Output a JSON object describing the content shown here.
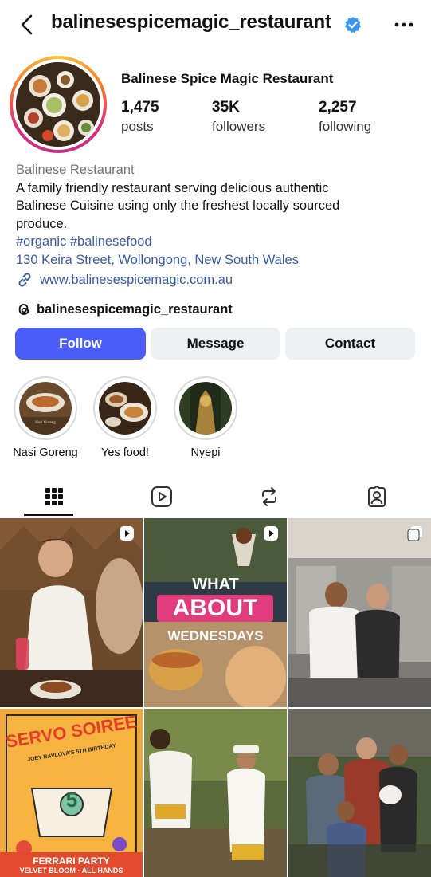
{
  "header": {
    "username": "balinesespicemagic_restaurant",
    "back_icon": "chevron-left-icon",
    "verified_icon": "verified-badge-icon",
    "more_icon": "more-horizontal-icon"
  },
  "profile": {
    "display_name": "Balinese Spice Magic Restaurant",
    "stats": [
      {
        "value": "1,475",
        "label": "posts"
      },
      {
        "value": "35K",
        "label": "followers"
      },
      {
        "value": "2,257",
        "label": "following"
      }
    ]
  },
  "bio": {
    "category": "Balinese Restaurant",
    "line1": "A family friendly restaurant serving delicious authentic",
    "line2": "Balinese Cuisine using only the freshest locally sourced",
    "line3": "produce.",
    "hashtags": "#organic #balinesefood",
    "address": "130 Keira Street, Wollongong, New South Wales",
    "website": "www.balinesespicemagic.com.au",
    "threads_handle": "balinesespicemagic_restaurant"
  },
  "actions": {
    "follow": "Follow",
    "message": "Message",
    "contact": "Contact"
  },
  "highlights": [
    {
      "label": "Nasi Goreng"
    },
    {
      "label": "Yes food!"
    },
    {
      "label": "Nyepi"
    }
  ],
  "tabs": [
    "grid-icon",
    "reels-icon",
    "reposts-icon",
    "tagged-icon"
  ],
  "posts": {
    "p2_line1": "WHAT",
    "p2_line2": "ABOUT",
    "p2_line3": "WEDNESDAYS",
    "p4_title": "SERVO SOIREE",
    "p4_sub": "JOEY BAVLOVA'S 5TH BIRTHDAY",
    "p4_number": "5",
    "p4_bottom1": "FERRARI PARTY",
    "p4_bottom2": "VELVET BLOOM · ALL HANDS"
  },
  "colors": {
    "accent": "#4a5df9",
    "link": "#385ba6",
    "verified": "#3897f0"
  }
}
